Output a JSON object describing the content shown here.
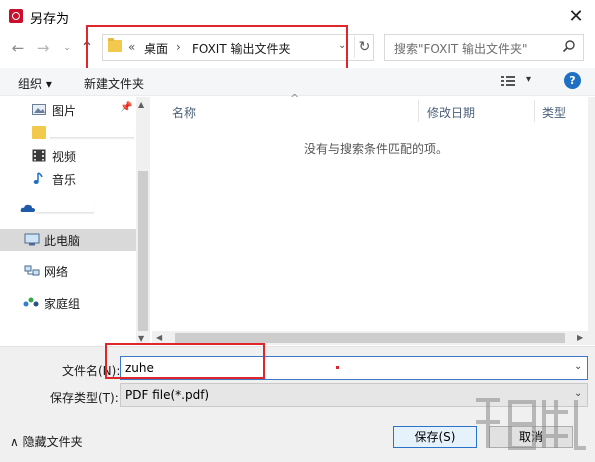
{
  "window": {
    "title": "另存为",
    "close_glyph": "✕"
  },
  "nav": {
    "back_glyph": "←",
    "forward_glyph": "→",
    "recent_glyph": "⌄",
    "up_glyph": "↑"
  },
  "address": {
    "overflow": "«",
    "crumbs": [
      "桌面",
      "FOXIT 输出文件夹"
    ],
    "separator": "›",
    "dropdown_glyph": "⌄",
    "refresh_glyph": "↻"
  },
  "search": {
    "placeholder": "搜索\"FOXIT 输出文件夹\""
  },
  "toolbar": {
    "organize_label": "组织 ▾",
    "new_folder_label": "新建文件夹",
    "view_dropdown_glyph": "▾",
    "help_glyph": "?"
  },
  "sidebar": {
    "items": [
      {
        "label": "图片",
        "icon": "pictures-icon",
        "pin": "📌"
      },
      {
        "label": "",
        "icon": "folder-icon"
      },
      {
        "label": "视频",
        "icon": "video-icon"
      },
      {
        "label": "音乐",
        "icon": "music-icon"
      },
      {
        "label": "",
        "icon": "onedrive-icon"
      },
      {
        "label": "此电脑",
        "icon": "computer-icon",
        "selected": true
      },
      {
        "label": "网络",
        "icon": "network-icon"
      },
      {
        "label": "家庭组",
        "icon": "homegroup-icon"
      }
    ],
    "scroll_up_glyph": "▲",
    "scroll_down_glyph": "▼"
  },
  "file_list": {
    "columns": [
      "名称",
      "修改日期",
      "类型"
    ],
    "sort_glyph": "^",
    "empty_message": "没有与搜索条件匹配的项。",
    "scroll_left_glyph": "◀",
    "scroll_right_glyph": "▶"
  },
  "form": {
    "filename_label": "文件名(N):",
    "filename_value": "zuhe",
    "filetype_label": "保存类型(T):",
    "filetype_value": "PDF file(*.pdf)",
    "dropdown_glyph": "⌄"
  },
  "footer": {
    "hide_folders_label": "∧ 隐藏文件夹",
    "save_label": "保存(S)",
    "cancel_label": "取消"
  },
  "colors": {
    "highlight_red": "#e0252b",
    "accent_blue": "#1f6fc5",
    "selected_bg": "#d9d9d9"
  }
}
